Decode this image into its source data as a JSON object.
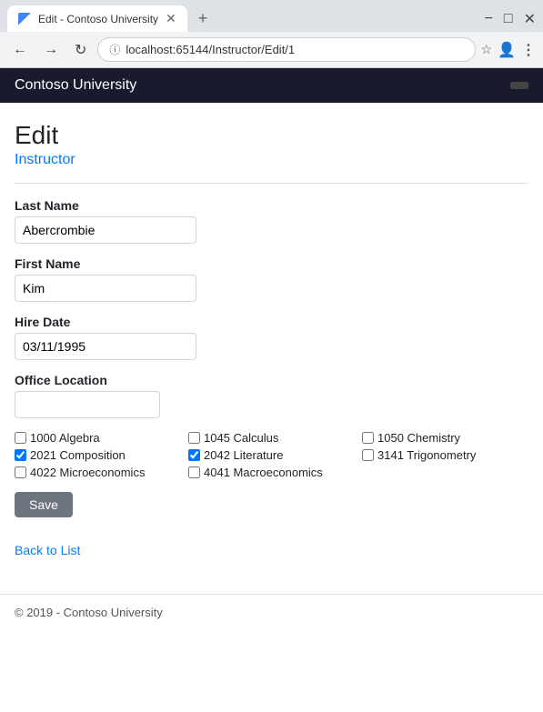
{
  "browser": {
    "tab_label": "Edit - Contoso University",
    "url": "localhost:65144/Instructor/Edit/1",
    "new_tab_icon": "+",
    "back_btn": "←",
    "forward_btn": "→",
    "reload_btn": "↻"
  },
  "nav": {
    "title": "Contoso University",
    "btn_label": ""
  },
  "page": {
    "title": "Edit",
    "subtitle": "Instructor"
  },
  "form": {
    "last_name_label": "Last Name",
    "last_name_value": "Abercrombie",
    "first_name_label": "First Name",
    "first_name_value": "Kim",
    "hire_date_label": "Hire Date",
    "hire_date_value": "03/11/1995",
    "office_location_label": "Office Location",
    "office_location_value": ""
  },
  "courses": [
    {
      "id": "1000",
      "name": "Algebra",
      "checked": false
    },
    {
      "id": "1045",
      "name": "Calculus",
      "checked": false
    },
    {
      "id": "1050",
      "name": "Chemistry",
      "checked": false
    },
    {
      "id": "2021",
      "name": "Composition",
      "checked": true
    },
    {
      "id": "2042",
      "name": "Literature",
      "checked": true
    },
    {
      "id": "3141",
      "name": "Trigonometry",
      "checked": false
    },
    {
      "id": "4022",
      "name": "Microeconomics",
      "checked": false
    },
    {
      "id": "4041",
      "name": "Macroeconomics",
      "checked": false
    }
  ],
  "save_btn": "Save",
  "back_link": "Back to List",
  "footer": "© 2019 - Contoso University"
}
